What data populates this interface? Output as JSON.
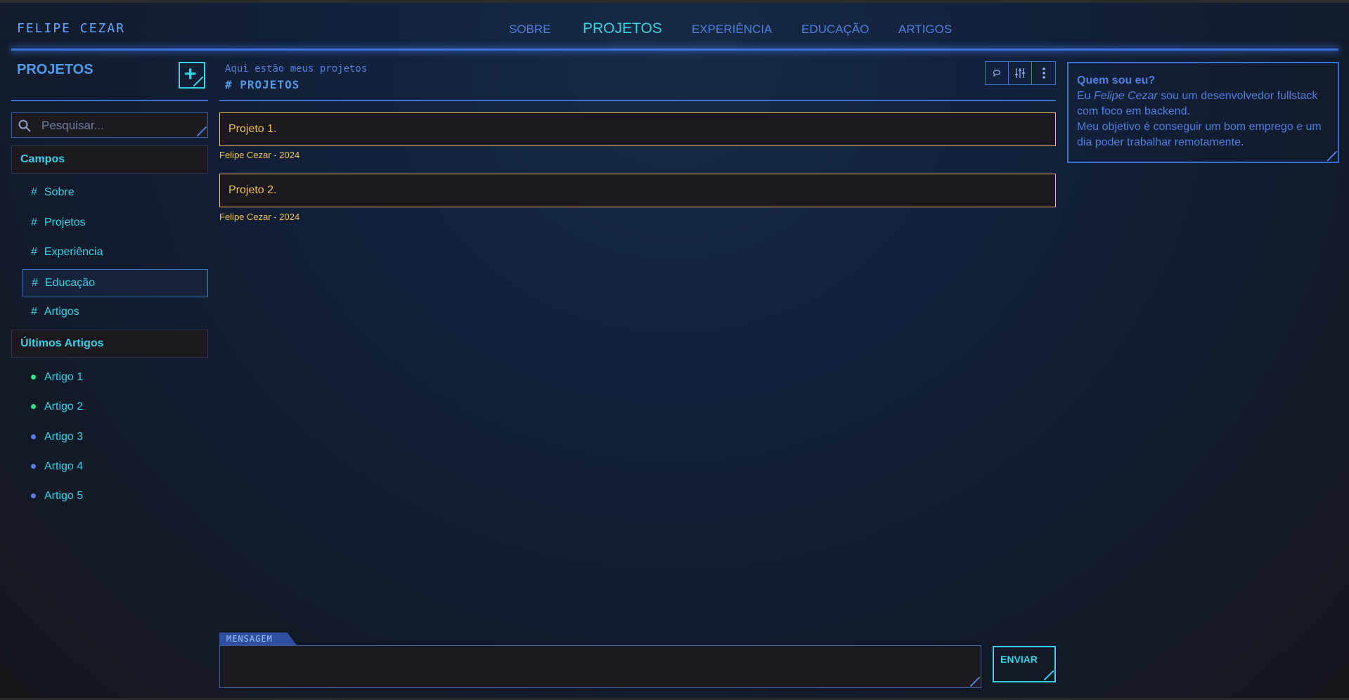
{
  "brand": "FELIPE CEZAR",
  "nav": {
    "items": [
      {
        "label": "SOBRE"
      },
      {
        "label": "PROJETOS"
      },
      {
        "label": "EXPERIÊNCIA"
      },
      {
        "label": "EDUCAÇÃO"
      },
      {
        "label": "ARTIGOS"
      }
    ],
    "active": "PROJETOS"
  },
  "sidebar": {
    "title": "PROJETOS",
    "add_button": "+",
    "search_placeholder": "Pesquisar...",
    "fields_heading": "Campos",
    "fields": [
      {
        "label": "Sobre"
      },
      {
        "label": "Projetos"
      },
      {
        "label": "Experiência"
      },
      {
        "label": "Educação"
      },
      {
        "label": "Artigos"
      }
    ],
    "selected_field": "Educação",
    "articles_heading": "Últimos Artigos",
    "articles": [
      {
        "label": "Artigo 1",
        "dot_color": "#2ee68a"
      },
      {
        "label": "Artigo 2",
        "dot_color": "#2ee68a"
      },
      {
        "label": "Artigo 3",
        "dot_color": "#5a7ce8"
      },
      {
        "label": "Artigo 4",
        "dot_color": "#5a7ce8"
      },
      {
        "label": "Artigo 5",
        "dot_color": "#5a7ce8"
      }
    ]
  },
  "main": {
    "subtitle": "Aqui estão meus projetos",
    "title": "# PROJETOS",
    "toolbar": [
      "chat-bubble-icon",
      "sliders-icon",
      "more-vertical-icon"
    ],
    "projects": [
      {
        "name": "Projeto 1.",
        "meta": "Felipe Cezar - 2024"
      },
      {
        "name": "Projeto 2.",
        "meta": "Felipe Cezar - 2024"
      }
    ]
  },
  "about": {
    "question": "Quem sou eu?",
    "line1_pre": "Eu ",
    "line1_name": "Felipe Cezar",
    "line1_post": " sou um desenvolvedor fullstack com foco em backend.",
    "line2": "Meu objetivo é conseguir um bom emprego e um dia poder trabalhar remotamente."
  },
  "message": {
    "tag": "MENSAGEM",
    "value": "",
    "send_label": "ENVIAR"
  },
  "colors": {
    "accent_cyan": "#33d2e6",
    "accent_blue": "#3a6fd8",
    "project_yellow": "#f1c34d"
  }
}
